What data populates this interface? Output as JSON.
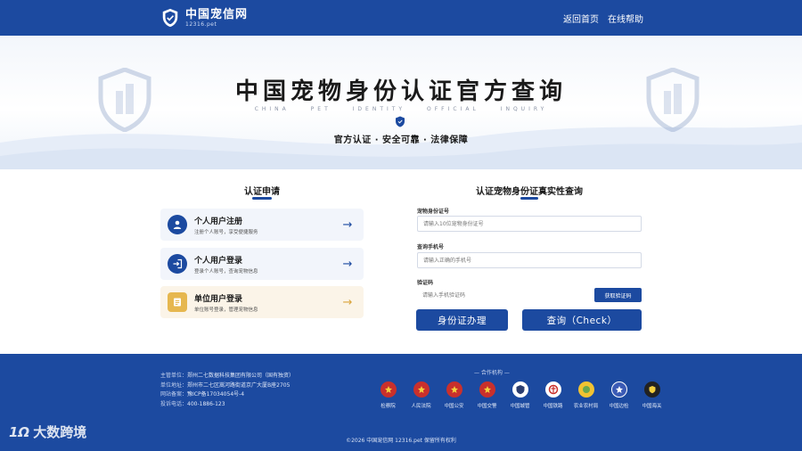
{
  "header": {
    "site_name": "中国宠信网",
    "site_domain": "12316.pet",
    "links": [
      "返回首页",
      "在线帮助"
    ]
  },
  "hero": {
    "title": "中国宠物身份认证官方查询",
    "subtitle_en": "CHINA PET IDENTITY OFFICIAL INQUIRY",
    "tagline": "官方认证 · 安全可靠 · 法律保障"
  },
  "apply": {
    "title": "认证申请",
    "cards": [
      {
        "title": "个人用户注册",
        "desc": "注册个人账号，享受便捷服务",
        "icon": "user-icon"
      },
      {
        "title": "个人用户登录",
        "desc": "登录个人账号，查询宠物信息",
        "icon": "login-icon"
      },
      {
        "title": "单位用户登录",
        "desc": "单位账号登录，管理宠物信息",
        "icon": "document-icon"
      }
    ]
  },
  "query": {
    "title": "认证宠物身份证真实性查询",
    "id_label": "宠物身份证号",
    "id_placeholder": "请输入10位宠物身份证号",
    "phone_label": "查询手机号",
    "phone_placeholder": "请输入正确的手机号",
    "code_label": "验证码",
    "code_placeholder": "请输入手机验证码",
    "get_code": "获取验证码",
    "apply_button": "身份证办理",
    "check_button": "查询（Check）"
  },
  "footer": {
    "info": [
      {
        "key": "主管单位：",
        "value": "郑州二七数据科技集团有限公司（国有独资）"
      },
      {
        "key": "单位地址：",
        "value": "郑州市二七区嵩河路街道京广大厦B座2705"
      },
      {
        "key": "网站备案：",
        "value": "豫ICP备17034054号-4"
      },
      {
        "key": "投诉电话：",
        "value": "400-1886-123"
      }
    ],
    "partners_title": "合作机构",
    "partners": [
      {
        "name": "检察院",
        "color": "#c9302c"
      },
      {
        "name": "人民法院",
        "color": "#c9302c"
      },
      {
        "name": "中国公安",
        "color": "#c9302c"
      },
      {
        "name": "中国交警",
        "color": "#c9302c"
      },
      {
        "name": "中国城管",
        "color": "#2c3e70"
      },
      {
        "name": "中国铁路",
        "color": "#c9302c"
      },
      {
        "name": "农业农村局",
        "color": "#6aa84f"
      },
      {
        "name": "中国边检",
        "color": "#3b5bb5"
      },
      {
        "name": "中国海关",
        "color": "#222222"
      }
    ],
    "copyright": "©2026  中国宠信网  12316.pet  保留所有权利"
  },
  "watermark": {
    "logo": "1Ω",
    "text": "大数跨境"
  },
  "colors": {
    "brand": "#1c4aa0",
    "gold": "#e6b74f"
  }
}
